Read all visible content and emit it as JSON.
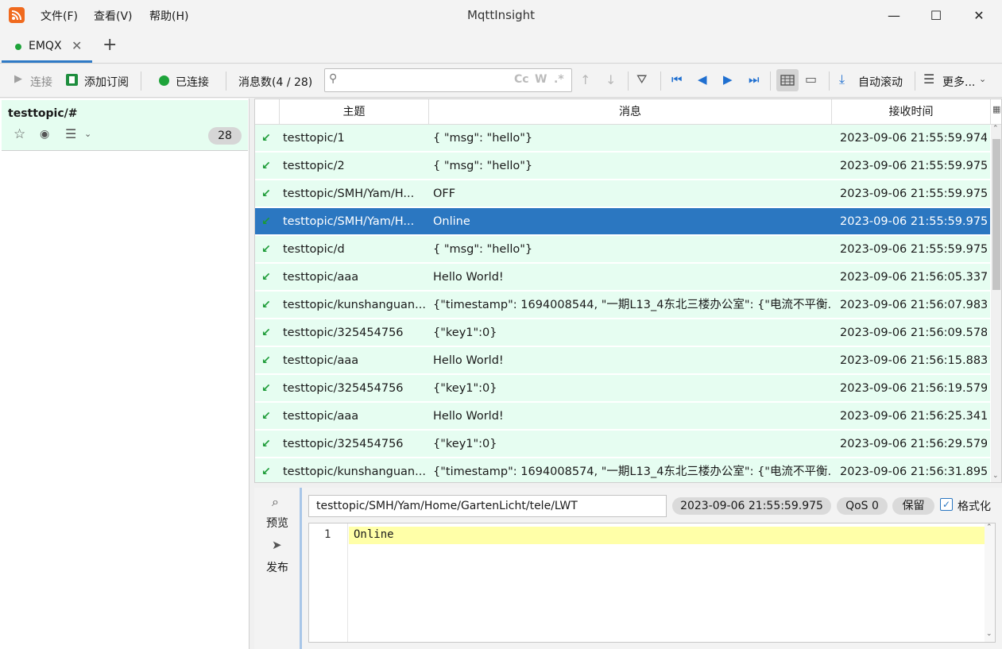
{
  "window": {
    "title": "MqttInsight",
    "menu": [
      "文件(F)",
      "查看(V)",
      "帮助(H)"
    ],
    "controls": {
      "minimize": "—",
      "maximize": "☐",
      "close": "✕"
    }
  },
  "tabs": [
    {
      "label": "EMQX",
      "status_color": "#1ea33a",
      "close": "✕"
    }
  ],
  "tab_add": "+",
  "toolbar": {
    "connect_label": "连接",
    "add_subscription_label": "添加订阅",
    "connected_label": "已连接",
    "message_count_label": "消息数(4 / 28)",
    "search_placeholder": "",
    "search_opts": [
      "Cc",
      "W",
      ".*"
    ],
    "auto_scroll_label": "自动滚动",
    "more_label": "更多..."
  },
  "subscription": {
    "topic": "testtopic/#",
    "count": "28"
  },
  "table": {
    "headers": [
      "主题",
      "消息",
      "接收时间"
    ],
    "rows": [
      {
        "topic": "testtopic/1",
        "message": "{  \"msg\": \"hello\"}",
        "time": "2023-09-06 21:55:59.974"
      },
      {
        "topic": "testtopic/2",
        "message": "{  \"msg\": \"hello\"}",
        "time": "2023-09-06 21:55:59.975"
      },
      {
        "topic": "testtopic/SMH/Yam/H...",
        "message": "OFF",
        "time": "2023-09-06 21:55:59.975"
      },
      {
        "topic": "testtopic/SMH/Yam/H...",
        "message": "Online",
        "time": "2023-09-06 21:55:59.975"
      },
      {
        "topic": "testtopic/d",
        "message": "{  \"msg\": \"hello\"}",
        "time": "2023-09-06 21:55:59.975"
      },
      {
        "topic": "testtopic/aaa",
        "message": "Hello World!",
        "time": "2023-09-06 21:56:05.337"
      },
      {
        "topic": "testtopic/kunshanguan...",
        "message": "{\"timestamp\": 1694008544, \"一期L13_4东北三楼办公室\": {\"电流不平衡...",
        "time": "2023-09-06 21:56:07.983"
      },
      {
        "topic": "testtopic/325454756",
        "message": "{\"key1\":0}",
        "time": "2023-09-06 21:56:09.578"
      },
      {
        "topic": "testtopic/aaa",
        "message": "Hello World!",
        "time": "2023-09-06 21:56:15.883"
      },
      {
        "topic": "testtopic/325454756",
        "message": "{\"key1\":0}",
        "time": "2023-09-06 21:56:19.579"
      },
      {
        "topic": "testtopic/aaa",
        "message": "Hello World!",
        "time": "2023-09-06 21:56:25.341"
      },
      {
        "topic": "testtopic/325454756",
        "message": "{\"key1\":0}",
        "time": "2023-09-06 21:56:29.579"
      },
      {
        "topic": "testtopic/kunshanguan...",
        "message": "{\"timestamp\": 1694008574, \"一期L13_4东北三楼办公室\": {\"电流不平衡...",
        "time": "2023-09-06 21:56:31.895"
      }
    ]
  },
  "detail": {
    "preview_label": "预览",
    "publish_label": "发布",
    "topic": "testtopic/SMH/Yam/Home/GartenLicht/tele/LWT",
    "time": "2023-09-06 21:55:59.975",
    "qos": "QoS 0",
    "retain": "保留",
    "format_label": "格式化",
    "line_number": "1",
    "payload": "Online"
  },
  "colors": {
    "accent": "#2b77c1",
    "row_bg": "#e6fdf1",
    "connected": "#1ea33a",
    "arrow": "#1b9a36"
  }
}
